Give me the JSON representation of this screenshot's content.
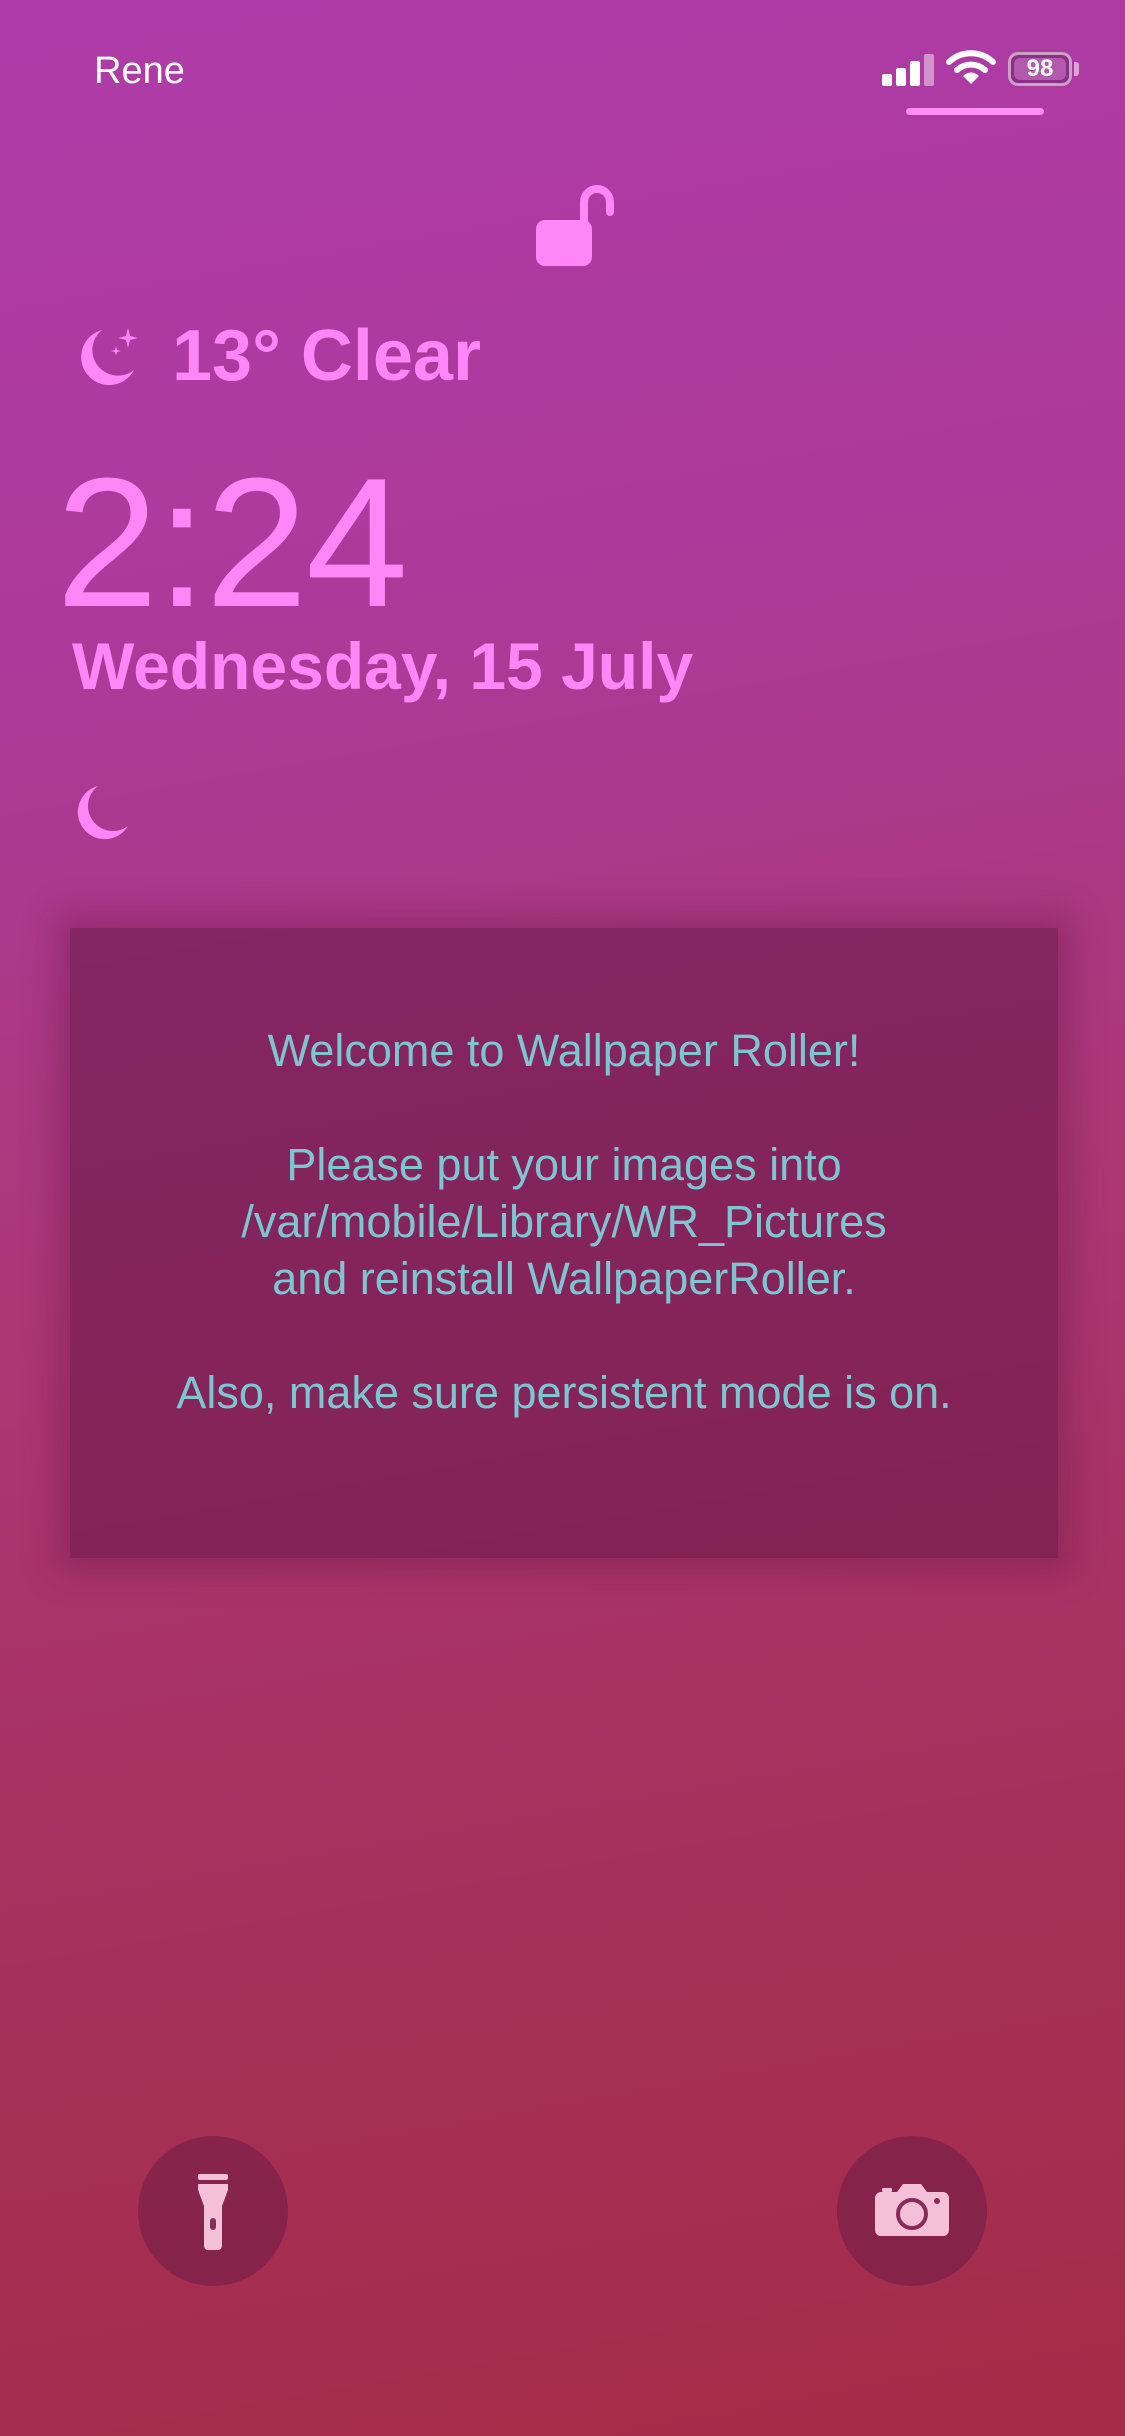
{
  "status_bar": {
    "carrier": "Rene",
    "battery": "98",
    "icons": [
      "signal-icon",
      "wifi-icon",
      "battery-icon"
    ]
  },
  "lock_icon": "unlocked-padlock-icon",
  "weather": {
    "icon": "moon-stars-icon",
    "text": "13° Clear"
  },
  "clock": {
    "time": "2:24",
    "date": "Wednesday, 15 July"
  },
  "dnd_icon": "moon-icon",
  "message": {
    "line1": "Welcome to Wallpaper Roller!",
    "line2": "Please put your images into",
    "line3": "/var/mobile/Library/WR_Pictures",
    "line4": "and reinstall WallpaperRoller.",
    "line5": "Also, make sure persistent mode is on."
  },
  "buttons": {
    "flashlight_icon": "flashlight-icon",
    "camera_icon": "camera-icon"
  },
  "colors": {
    "accent": "#ff86f6",
    "message_text": "#7dc6d1",
    "background_top": "#ae3ba8",
    "background_bottom": "#a42c47"
  }
}
